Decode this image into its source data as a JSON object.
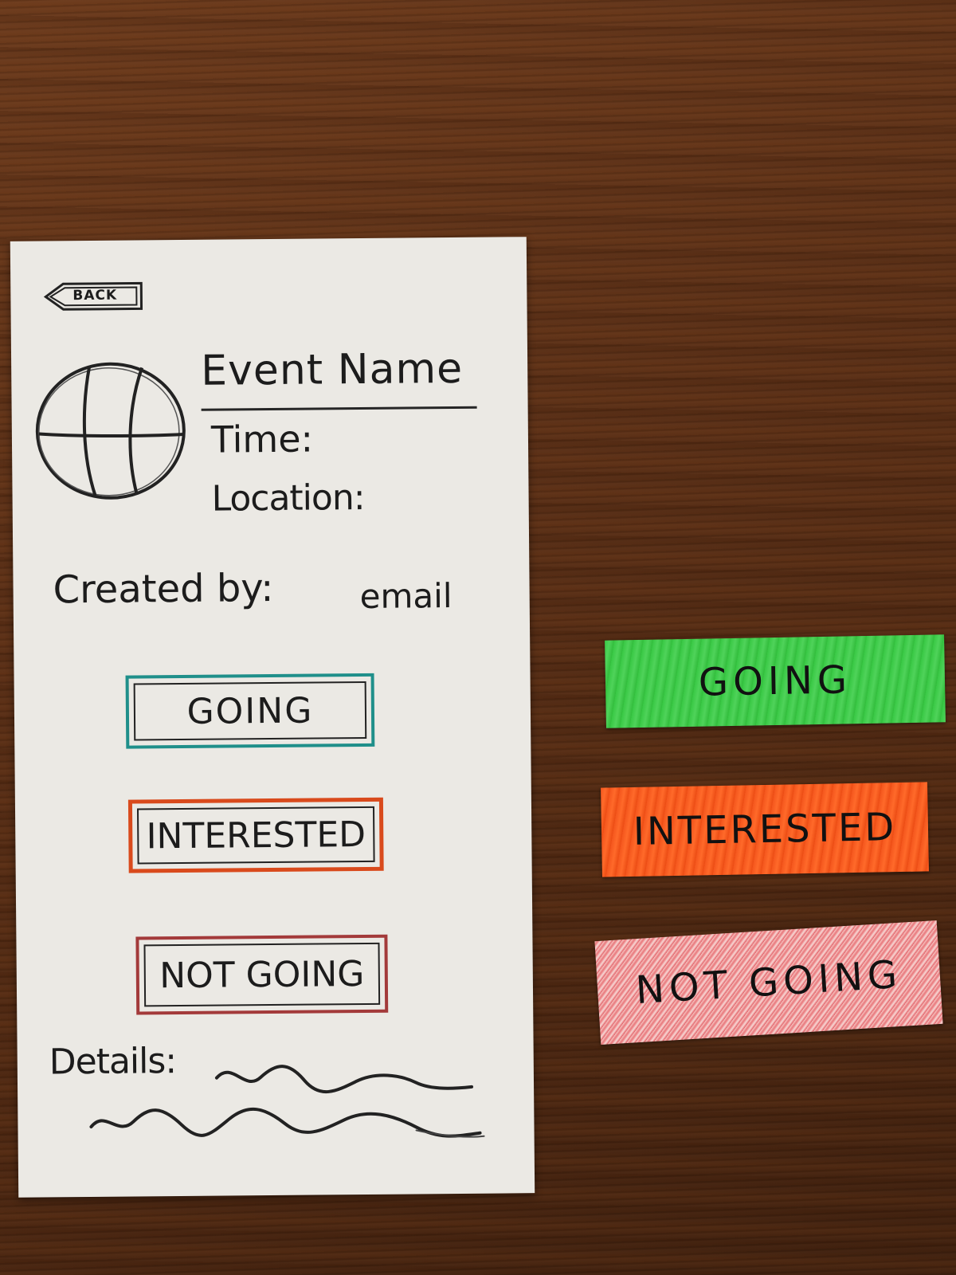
{
  "screen": {
    "back_label": "BACK",
    "event_name": "Event Name",
    "time_label": "Time:",
    "location_label": "Location:",
    "created_by_label": "Created by:",
    "created_by_value": "email",
    "buttons": {
      "going": "GOING",
      "interested": "INTERESTED",
      "not_going": "NOT GOING"
    },
    "details_label": "Details:",
    "avatar_icon": "basketball-icon"
  },
  "cutouts": {
    "going": "GOING",
    "interested": "INTERESTED",
    "not_going": "NOT GOING"
  },
  "colors": {
    "going_outline": "#1f8f8a",
    "interested_outline": "#d94a1c",
    "not_going_outline": "#a33a3a",
    "going_fill": "#38c844",
    "interested_fill": "#f4561d",
    "not_going_fill": "#e9767a"
  }
}
